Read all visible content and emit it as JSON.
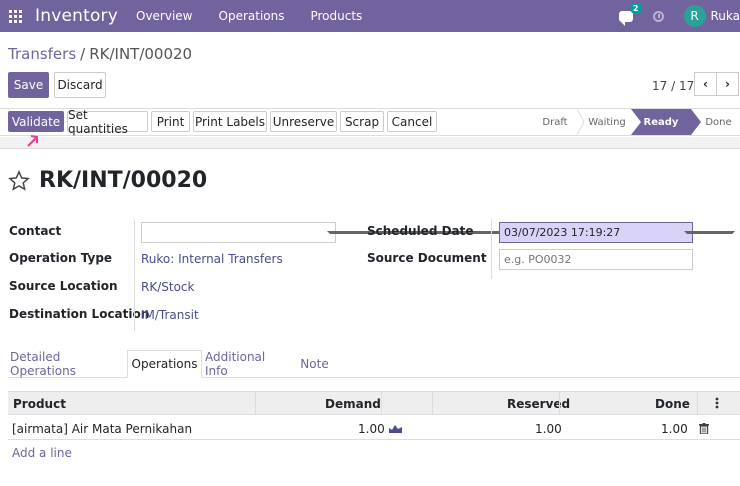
{
  "app": {
    "name": "Inventory"
  },
  "nav": {
    "menu": [
      "Overview",
      "Operations",
      "Products"
    ],
    "chat_badge": "2",
    "user_initial": "R",
    "user_name": "Ruka"
  },
  "breadcrumb": {
    "parent": "Transfers",
    "separator": "/",
    "current": "RK/INT/00020"
  },
  "form_buttons": {
    "save": "Save",
    "discard": "Discard"
  },
  "pager": {
    "value": "17 / 17",
    "prev": "‹",
    "next": "›"
  },
  "actions": {
    "validate": "Validate",
    "set_quantities": "Set quantities",
    "print": "Print",
    "print_labels": "Print Labels",
    "unreserve": "Unreserve",
    "scrap": "Scrap",
    "cancel": "Cancel"
  },
  "stages": {
    "draft": "Draft",
    "waiting": "Waiting",
    "ready": "Ready",
    "done": "Done",
    "current": "Ready"
  },
  "record": {
    "name": "RK/INT/00020",
    "labels": {
      "contact": "Contact",
      "operation_type": "Operation Type",
      "source_location": "Source Location",
      "destination_location": "Destination Location",
      "scheduled_date": "Scheduled Date",
      "source_document": "Source Document"
    },
    "contact": "",
    "operation_type": "Ruko: Internal Transfers",
    "source_location": "RK/Stock",
    "destination_location": "IM/Transit",
    "scheduled_date": "03/07/2023 17:19:27",
    "source_document_placeholder": "e.g. PO0032"
  },
  "tabs": [
    "Detailed Operations",
    "Operations",
    "Additional Info",
    "Note"
  ],
  "active_tab": "Operations",
  "table": {
    "headers": {
      "product": "Product",
      "demand": "Demand",
      "reserved": "Reserved",
      "done": "Done"
    },
    "rows": [
      {
        "product": "[airmata] Air Mata Pernikahan",
        "demand": "1.00",
        "reserved": "1.00",
        "done": "1.00"
      }
    ],
    "add_line": "Add a line"
  },
  "colors": {
    "brand": "#71639e",
    "highlight": "#d9d3f7",
    "arrow": "#e83e8c"
  }
}
